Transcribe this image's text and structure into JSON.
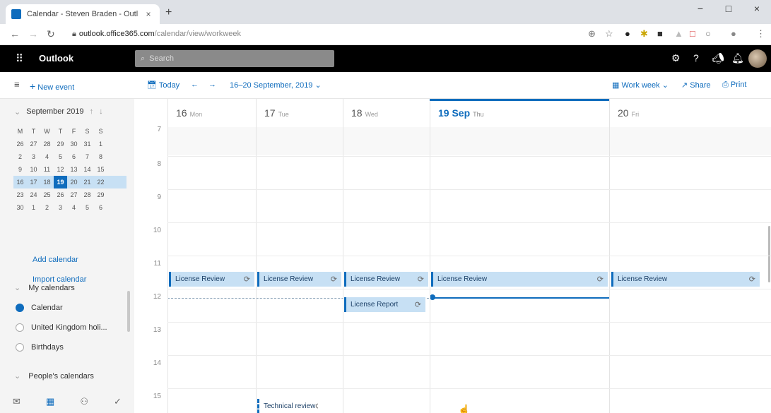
{
  "browser": {
    "tab_title": "Calendar - Steven Braden - Outl",
    "tab_close": "×",
    "new_tab": "+",
    "url_host": "outlook.office365.com",
    "url_path": "/calendar/view/workweek",
    "win_min": "−",
    "win_max": "□",
    "win_close": "×"
  },
  "suite": {
    "app_name": "Outlook",
    "search_placeholder": "Search"
  },
  "commands": {
    "new_event": "New event",
    "today": "Today",
    "date_range": "16–20 September, 2019",
    "view": "Work week",
    "share": "Share",
    "print": "Print"
  },
  "mini_calendar": {
    "month": "September 2019",
    "weekdays": [
      "M",
      "T",
      "W",
      "T",
      "F",
      "S",
      "S"
    ],
    "weeks": [
      [
        "26",
        "27",
        "28",
        "29",
        "30",
        "31",
        "1"
      ],
      [
        "2",
        "3",
        "4",
        "5",
        "6",
        "7",
        "8"
      ],
      [
        "9",
        "10",
        "11",
        "12",
        "13",
        "14",
        "15"
      ],
      [
        "16",
        "17",
        "18",
        "19",
        "20",
        "21",
        "22"
      ],
      [
        "23",
        "24",
        "25",
        "26",
        "27",
        "28",
        "29"
      ],
      [
        "30",
        "1",
        "2",
        "3",
        "4",
        "5",
        "6"
      ]
    ],
    "selected_day": "19"
  },
  "sidebar": {
    "add_calendar": "Add calendar",
    "import_calendar": "Import calendar",
    "my_calendars": "My calendars",
    "calendars": [
      {
        "label": "Calendar",
        "checked": true
      },
      {
        "label": "United Kingdom holi...",
        "checked": false
      },
      {
        "label": "Birthdays",
        "checked": false
      }
    ],
    "peoples_calendars": "People's calendars"
  },
  "days": [
    {
      "date": "16",
      "name": "Mon"
    },
    {
      "date": "17",
      "name": "Tue"
    },
    {
      "date": "18",
      "name": "Wed"
    },
    {
      "date": "19 Sep",
      "name": "Thu"
    },
    {
      "date": "20",
      "name": "Fri"
    }
  ],
  "hours": [
    "7",
    "8",
    "9",
    "10",
    "11",
    "12",
    "13",
    "14",
    "15"
  ],
  "events": {
    "license_review": "License Review",
    "license_report": "License Report",
    "technical_review": "Technical review"
  },
  "colors": {
    "accent": "#0f6cbd",
    "event_fill": "#c7e0f4"
  }
}
